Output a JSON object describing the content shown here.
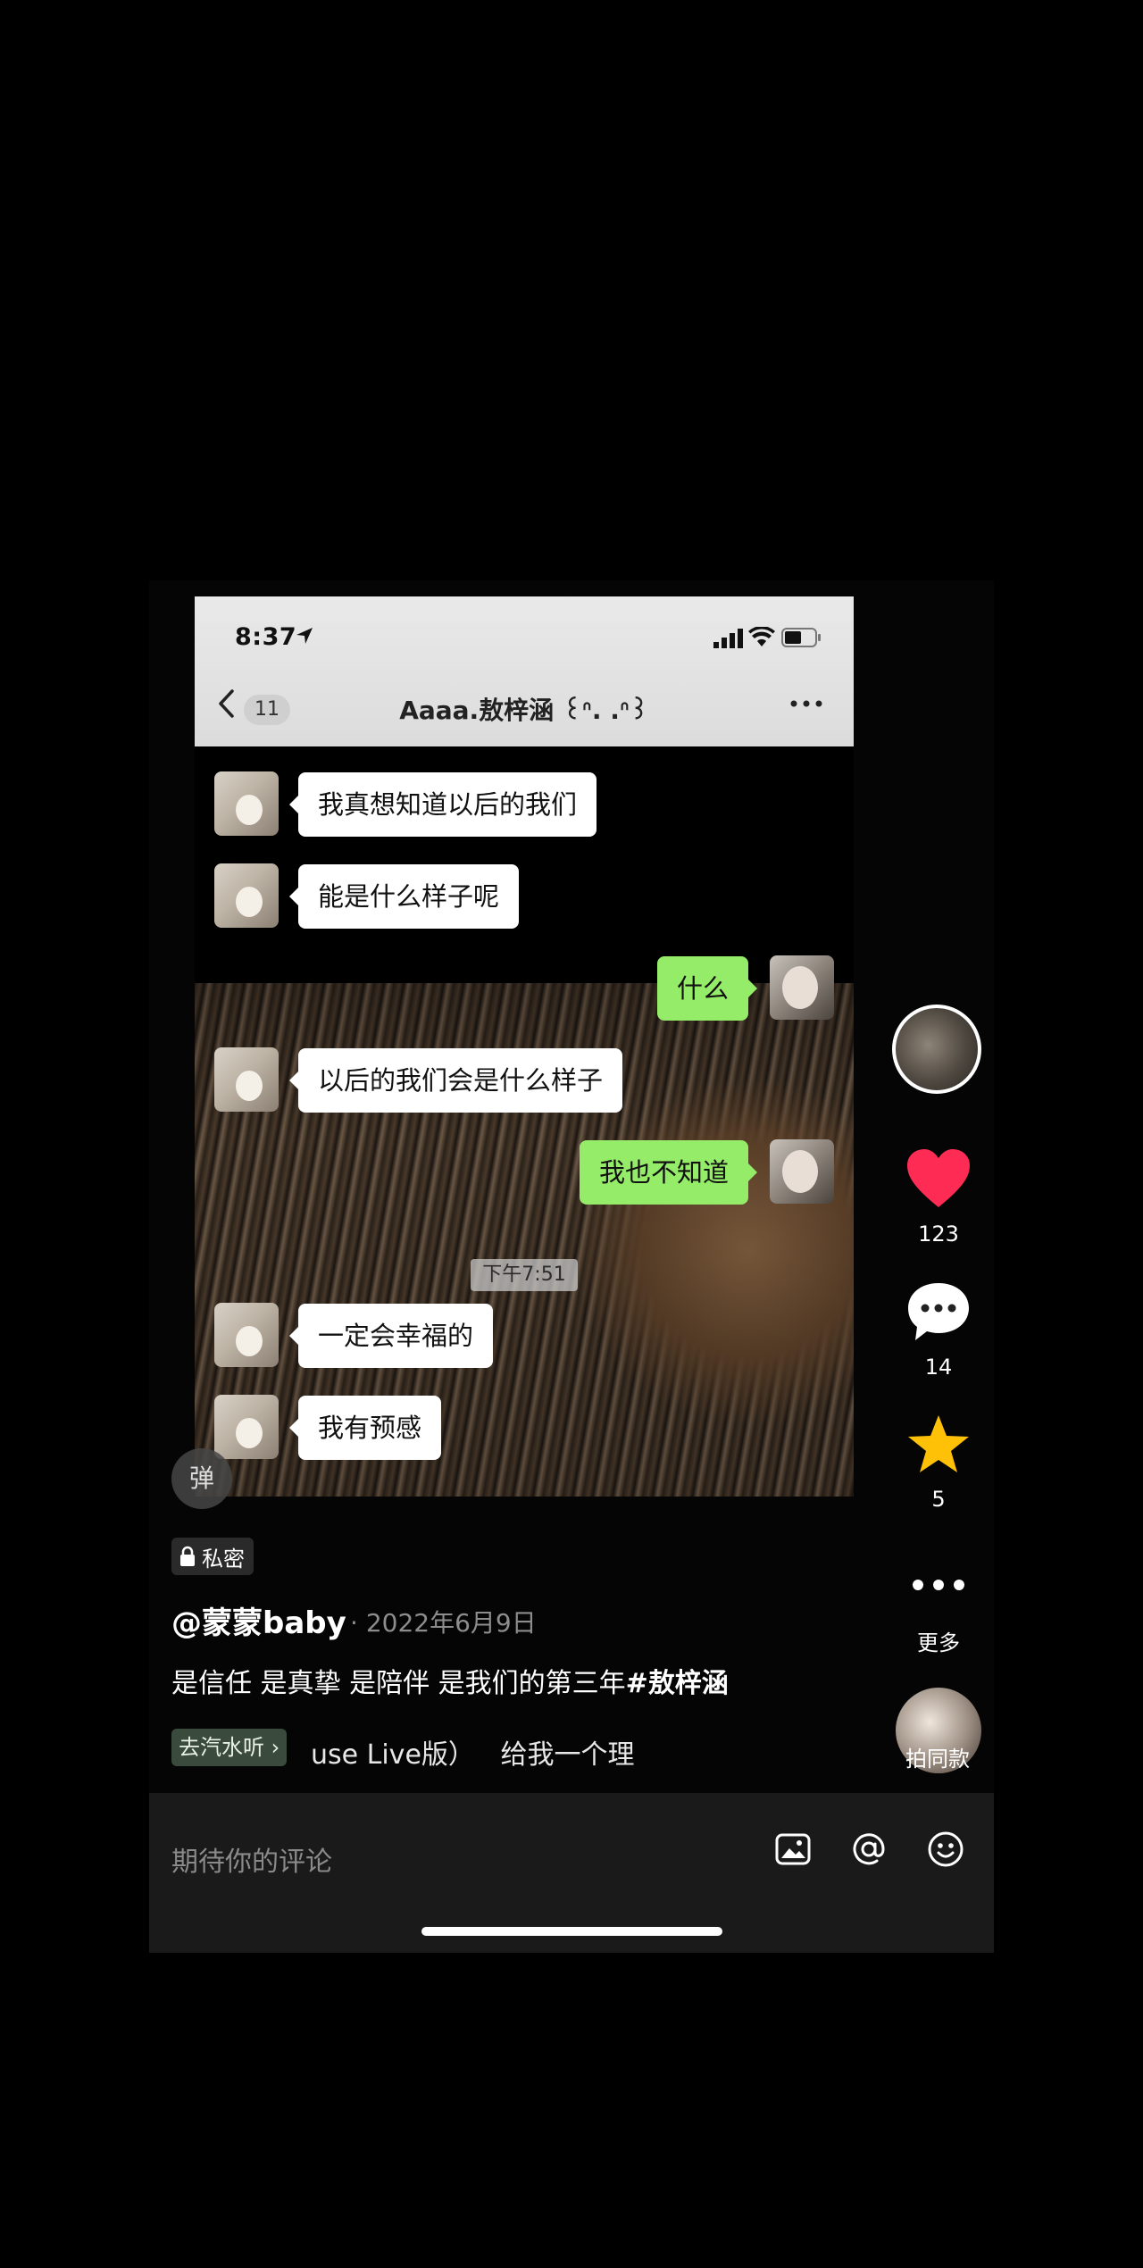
{
  "chat": {
    "status_time": "8:37",
    "back_count": "11",
    "contact_name": "Aaaa.敖梓涵 ꒰ᐢ. .ᐢ꒱",
    "messages": [
      {
        "side": "left",
        "text": "我真想知道以后的我们"
      },
      {
        "side": "left",
        "text": "能是什么样子呢"
      },
      {
        "side": "right",
        "text": "什么"
      },
      {
        "side": "left",
        "text": "以后的我们会是什么样子"
      },
      {
        "side": "right",
        "text": "我也不知道"
      },
      {
        "side": "left",
        "text": "一定会幸福的"
      },
      {
        "side": "left",
        "text": "我有预感"
      }
    ],
    "timestamp": "下午7:51"
  },
  "rail": {
    "likes": "123",
    "comments": "14",
    "favorites": "5",
    "more_label": "更多",
    "same_label": "拍同款",
    "like_color": "#fe2c55",
    "fav_color": "#ffc107"
  },
  "danmu_label": "弹",
  "private_label": "私密",
  "author": "@蒙蒙baby",
  "date": "2022年6月9日",
  "description": "是信任 是真挚 是陪伴 是我们的第三年",
  "hashtag": "#敖梓涵",
  "music": {
    "tag": "去汽水听",
    "text": "use Live版）   给我一个理"
  },
  "comment_bar": {
    "placeholder": "期待你的评论"
  }
}
